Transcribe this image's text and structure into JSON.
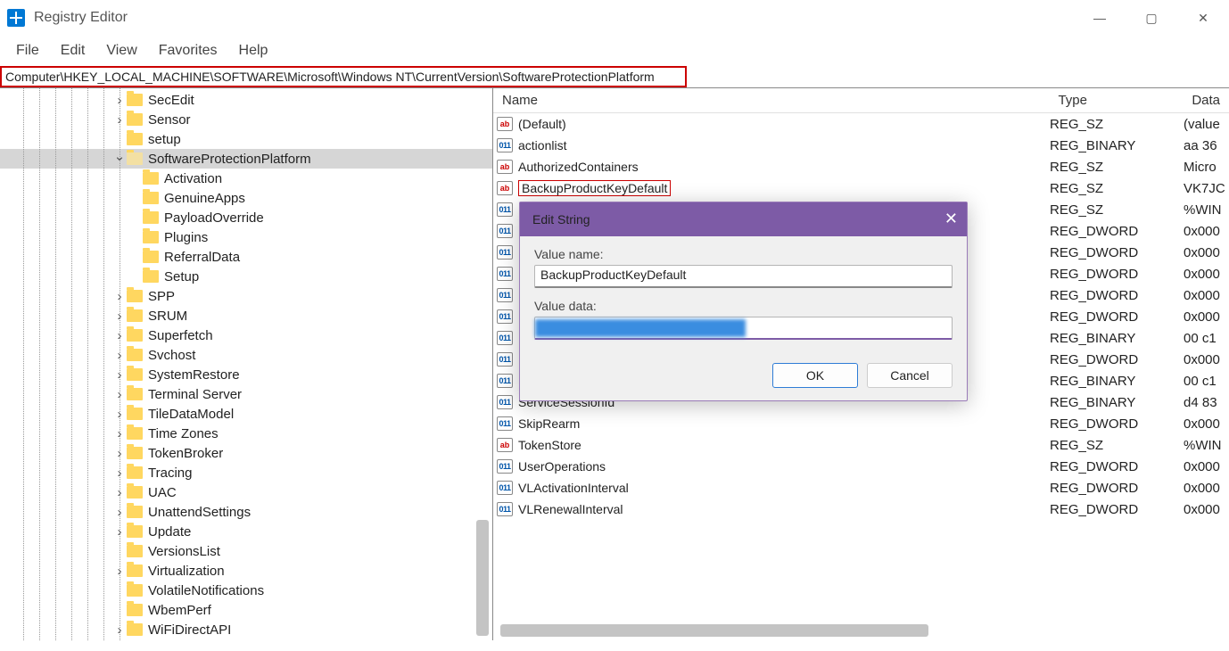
{
  "window": {
    "title": "Registry Editor"
  },
  "menu": {
    "file": "File",
    "edit": "Edit",
    "view": "View",
    "favorites": "Favorites",
    "help": "Help"
  },
  "address": "Computer\\HKEY_LOCAL_MACHINE\\SOFTWARE\\Microsoft\\Windows NT\\CurrentVersion\\SoftwareProtectionPlatform",
  "tree": [
    {
      "d": 7,
      "e": "r",
      "n": "SecEdit"
    },
    {
      "d": 7,
      "e": "r",
      "n": "Sensor"
    },
    {
      "d": 7,
      "e": "",
      "n": "setup"
    },
    {
      "d": 7,
      "e": "d",
      "n": "SoftwareProtectionPlatform",
      "sel": true,
      "open": true
    },
    {
      "d": 8,
      "e": "",
      "n": "Activation"
    },
    {
      "d": 8,
      "e": "",
      "n": "GenuineApps"
    },
    {
      "d": 8,
      "e": "",
      "n": "PayloadOverride"
    },
    {
      "d": 8,
      "e": "",
      "n": "Plugins"
    },
    {
      "d": 8,
      "e": "",
      "n": "ReferralData"
    },
    {
      "d": 8,
      "e": "",
      "n": "Setup"
    },
    {
      "d": 7,
      "e": "r",
      "n": "SPP"
    },
    {
      "d": 7,
      "e": "r",
      "n": "SRUM"
    },
    {
      "d": 7,
      "e": "r",
      "n": "Superfetch"
    },
    {
      "d": 7,
      "e": "r",
      "n": "Svchost"
    },
    {
      "d": 7,
      "e": "r",
      "n": "SystemRestore"
    },
    {
      "d": 7,
      "e": "r",
      "n": "Terminal Server"
    },
    {
      "d": 7,
      "e": "r",
      "n": "TileDataModel"
    },
    {
      "d": 7,
      "e": "r",
      "n": "Time Zones"
    },
    {
      "d": 7,
      "e": "r",
      "n": "TokenBroker"
    },
    {
      "d": 7,
      "e": "r",
      "n": "Tracing"
    },
    {
      "d": 7,
      "e": "r",
      "n": "UAC"
    },
    {
      "d": 7,
      "e": "r",
      "n": "UnattendSettings"
    },
    {
      "d": 7,
      "e": "r",
      "n": "Update"
    },
    {
      "d": 7,
      "e": "",
      "n": "VersionsList"
    },
    {
      "d": 7,
      "e": "r",
      "n": "Virtualization"
    },
    {
      "d": 7,
      "e": "",
      "n": "VolatileNotifications"
    },
    {
      "d": 7,
      "e": "",
      "n": "WbemPerf"
    },
    {
      "d": 7,
      "e": "r",
      "n": "WiFiDirectAPI"
    }
  ],
  "columns": {
    "name": "Name",
    "type": "Type",
    "data": "Data"
  },
  "values": [
    {
      "i": "sz",
      "n": "(Default)",
      "t": "REG_SZ",
      "d": "(value"
    },
    {
      "i": "bn",
      "n": "actionlist",
      "t": "REG_BINARY",
      "d": "aa 36"
    },
    {
      "i": "sz",
      "n": "AuthorizedContainers",
      "t": "REG_SZ",
      "d": "Micro"
    },
    {
      "i": "sz",
      "n": "BackupProductKeyDefault",
      "t": "REG_SZ",
      "d": "VK7JC",
      "hl": true
    },
    {
      "i": "bn",
      "n": "",
      "t": "REG_SZ",
      "d": "%WIN"
    },
    {
      "i": "dw",
      "n": "",
      "t": "REG_DWORD",
      "d": "0x000"
    },
    {
      "i": "dw",
      "n": "",
      "t": "REG_DWORD",
      "d": "0x000"
    },
    {
      "i": "dw",
      "n": "",
      "t": "REG_DWORD",
      "d": "0x000"
    },
    {
      "i": "dw",
      "n": "",
      "t": "REG_DWORD",
      "d": "0x000"
    },
    {
      "i": "dw",
      "n": "",
      "t": "REG_DWORD",
      "d": "0x000"
    },
    {
      "i": "bn",
      "n": "",
      "t": "REG_BINARY",
      "d": "00 c1"
    },
    {
      "i": "dw",
      "n": "",
      "t": "REG_DWORD",
      "d": "0x000"
    },
    {
      "i": "bn",
      "n": "",
      "t": "REG_BINARY",
      "d": "00 c1"
    },
    {
      "i": "bn",
      "n": "ServiceSessionId",
      "t": "REG_BINARY",
      "d": "d4 83"
    },
    {
      "i": "dw",
      "n": "SkipRearm",
      "t": "REG_DWORD",
      "d": "0x000"
    },
    {
      "i": "sz",
      "n": "TokenStore",
      "t": "REG_SZ",
      "d": "%WIN"
    },
    {
      "i": "dw",
      "n": "UserOperations",
      "t": "REG_DWORD",
      "d": "0x000"
    },
    {
      "i": "dw",
      "n": "VLActivationInterval",
      "t": "REG_DWORD",
      "d": "0x000"
    },
    {
      "i": "dw",
      "n": "VLRenewalInterval",
      "t": "REG_DWORD",
      "d": "0x000"
    }
  ],
  "dialog": {
    "title": "Edit String",
    "name_label": "Value name:",
    "name_value": "BackupProductKeyDefault",
    "data_label": "Value data:",
    "ok": "OK",
    "cancel": "Cancel"
  }
}
